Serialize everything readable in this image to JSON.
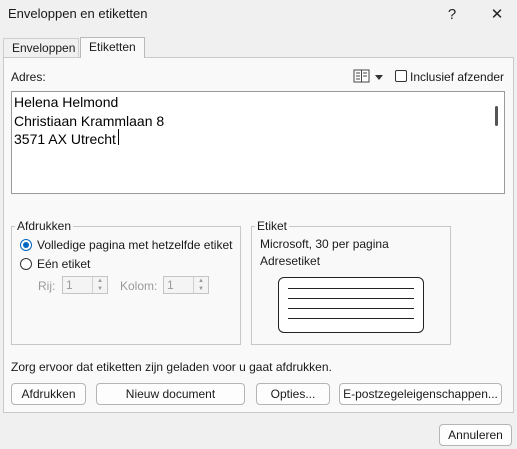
{
  "window": {
    "title": "Enveloppen en etiketten",
    "help_glyph": "?",
    "close_glyph": "✕"
  },
  "tabs": [
    {
      "label": "Enveloppen"
    },
    {
      "label": "Etiketten"
    }
  ],
  "address": {
    "label": "Adres:",
    "lines": [
      "Helena Helmond",
      "Christiaan Krammlaan 8",
      "3571 AX Utrecht"
    ],
    "include_sender_label": "Inclusief afzender",
    "include_sender_checked": false
  },
  "print_group": {
    "title": "Afdrukken",
    "options": [
      {
        "label": "Volledige pagina met hetzelfde etiket",
        "selected": true
      },
      {
        "label": "Eén etiket",
        "selected": false
      }
    ],
    "row_label": "Rij:",
    "row_value": "1",
    "col_label": "Kolom:",
    "col_value": "1"
  },
  "label_group": {
    "title": "Etiket",
    "vendor": "Microsoft, 30 per pagina",
    "type": "Adresetiket"
  },
  "notice": "Zorg ervoor dat etiketten zijn geladen voor u gaat afdrukken.",
  "buttons": {
    "print": "Afdrukken",
    "new_document": "Nieuw document",
    "options": "Opties...",
    "epostage": "E-postzegeleigenschappen...",
    "cancel": "Annuleren"
  },
  "colors": {
    "accent": "#0067c0",
    "panel": "#f9f9f9",
    "window": "#f0f0f0"
  }
}
